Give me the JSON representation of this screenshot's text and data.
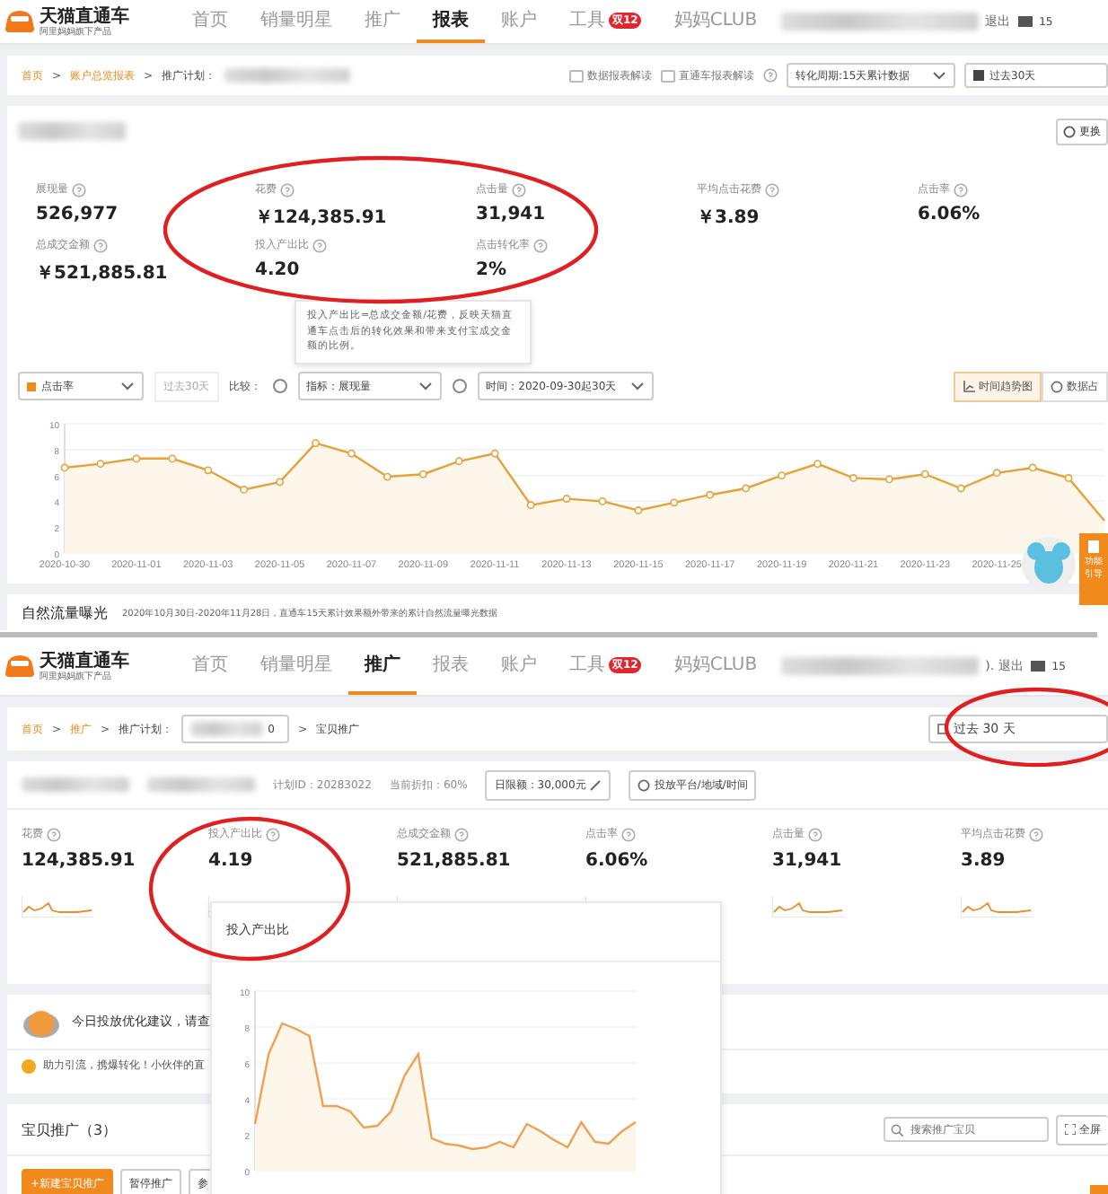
{
  "top_view": {
    "nav": {
      "logo": "天猫直通车",
      "logo_sub": "阿里妈妈旗下产品",
      "items": [
        {
          "label": "首页",
          "selected": false
        },
        {
          "label": "销量明星",
          "selected": false
        },
        {
          "label": "推广",
          "selected": false
        },
        {
          "label": "报表",
          "selected": true
        },
        {
          "label": "账户",
          "selected": false
        },
        {
          "label": "工具",
          "selected": false,
          "badge": "双12"
        },
        {
          "label": "妈妈CLUB",
          "selected": false
        }
      ],
      "user_action": "退出",
      "messages": "15"
    },
    "breadcrumb_separator": ">",
    "breadcrumb": [
      {
        "label": "首页",
        "kind": "link"
      },
      {
        "label": "账户总览报表",
        "kind": "link"
      },
      {
        "label": "推广计划：",
        "kind": "text"
      }
    ],
    "toggles": [
      {
        "label": "数据报表解读",
        "checked": false
      },
      {
        "label": "直通车报表解读",
        "checked": false
      }
    ],
    "attribution_select": "转化周期:15天累计数据",
    "date_range": "过去30天",
    "more_button": "更换",
    "metrics": [
      {
        "label": "展现量",
        "value": "526,977"
      },
      {
        "label": "花费",
        "value": "￥124,385.91"
      },
      {
        "label": "点击量",
        "value": "31,941"
      },
      {
        "label": "平均点击花费",
        "value": "￥3.89"
      },
      {
        "label": "点击率",
        "value": "6.06%"
      },
      {
        "label": "总成交金额",
        "value": "￥521,885.81"
      },
      {
        "label": "投入产出比",
        "value": "4.20"
      },
      {
        "label": "点击转化率",
        "value": "2%"
      }
    ],
    "tooltip": "投入产出比=总成交金额/花费，反映天猫直通车点击后的转化效果和带来支付宝成交金额的比例。",
    "controls": {
      "metric_select": "点击率",
      "compare_button": "过去30天",
      "compare_label": "比较：",
      "radios": [
        {
          "selected": false
        },
        {
          "selected": false
        }
      ],
      "compare_select": "指标：展现量",
      "time_select": "时间：2020-09-30起30天",
      "view_tabs": [
        {
          "label": "时间趋势图",
          "selected": true
        },
        {
          "label": "数据占",
          "selected": false
        }
      ]
    },
    "chart_data": {
      "type": "area",
      "grid": true,
      "ylim": [
        0,
        10
      ],
      "yticks": [
        0,
        2,
        4,
        6,
        8,
        10
      ],
      "categories": [
        "2020-10-30",
        null,
        "2020-11-01",
        null,
        "2020-11-03",
        null,
        "2020-11-05",
        null,
        "2020-11-07",
        null,
        "2020-11-09",
        null,
        "2020-11-11",
        null,
        "2020-11-13",
        null,
        "2020-11-15",
        null,
        "2020-11-17",
        null,
        "2020-11-19",
        null,
        "2020-11-21",
        null,
        "2020-11-23",
        null,
        "2020-11-25",
        null,
        null,
        null
      ],
      "series": [
        {
          "color": "#e5a23a",
          "values": [
            6.6,
            6.9,
            7.3,
            7.3,
            6.4,
            4.9,
            5.5,
            8.5,
            7.7,
            5.9,
            6.1,
            7.1,
            7.7,
            3.7,
            4.2,
            4.0,
            3.3,
            3.9,
            4.5,
            5.0,
            6.0,
            6.9,
            5.8,
            5.7,
            6.1,
            5.0,
            6.2,
            6.6,
            5.8,
            2.5
          ]
        }
      ]
    },
    "section_title": "自然流量曝光",
    "section_note": "2020年10月30日-2020年11月28日，直通车15天累计效果额外带来的累计自然流量曝光数据",
    "guide_button": "功能引导"
  },
  "bottom_view": {
    "nav": {
      "logo": "天猫直通车",
      "logo_sub": "阿里妈妈旗下产品",
      "items": [
        {
          "label": "首页",
          "selected": false
        },
        {
          "label": "销量明星",
          "selected": false
        },
        {
          "label": "推广",
          "selected": true
        },
        {
          "label": "报表",
          "selected": false
        },
        {
          "label": "账户",
          "selected": false
        },
        {
          "label": "工具",
          "selected": false,
          "badge": "双12"
        },
        {
          "label": "妈妈CLUB",
          "selected": false
        }
      ],
      "user_action": "). 退出",
      "messages": "15"
    },
    "breadcrumb_separator": ">",
    "breadcrumb": [
      {
        "label": "首页",
        "kind": "link"
      },
      {
        "label": "推广",
        "kind": "link"
      },
      {
        "label": "推广计划：",
        "kind": "text"
      }
    ],
    "plan_select": "0",
    "breadcrumb_tail": "宝贝推广",
    "date_range": "过去 30 天",
    "plan_id": "计划ID：20283022",
    "discount": "当前折扣：60%",
    "budget_button": "日限额：30,000元",
    "platform_button": "投放平台/地域/时间",
    "metrics": [
      {
        "label": "花费",
        "value": "124,385.91"
      },
      {
        "label": "投入产出比",
        "value": "4.19"
      },
      {
        "label": "总成交金额",
        "value": "521,885.81"
      },
      {
        "label": "点击率",
        "value": "6.06%"
      },
      {
        "label": "点击量",
        "value": "31,941"
      },
      {
        "label": "平均点击花费",
        "value": "3.89"
      }
    ],
    "tips": [
      "今日投放优化建议，请查",
      "助力引流，携爆转化！小伙伴的直"
    ],
    "products_title": "宝贝推广（3）",
    "search_placeholder": "搜索推广宝贝",
    "fullscreen_button": "全屏",
    "buttons": [
      {
        "label": "+新建宝贝推广",
        "kind": "primary"
      },
      {
        "label": "暂停推广",
        "kind": "plain"
      },
      {
        "label": "参",
        "kind": "plain"
      }
    ],
    "chart_data": {
      "type": "area",
      "title": "投入产出比",
      "grid": true,
      "ylim": [
        0,
        10
      ],
      "yticks": [
        0,
        2,
        4,
        6,
        8,
        10
      ],
      "series": [
        {
          "color": "#f0a050",
          "values": [
            2.6,
            6.5,
            8.2,
            7.9,
            7.5,
            3.6,
            3.6,
            3.3,
            2.4,
            2.5,
            3.3,
            5.3,
            6.5,
            1.8,
            1.5,
            1.4,
            1.2,
            1.3,
            1.6,
            1.3,
            2.6,
            2.2,
            1.7,
            1.3,
            2.7,
            1.6,
            1.5,
            2.2,
            2.7
          ]
        }
      ]
    }
  }
}
